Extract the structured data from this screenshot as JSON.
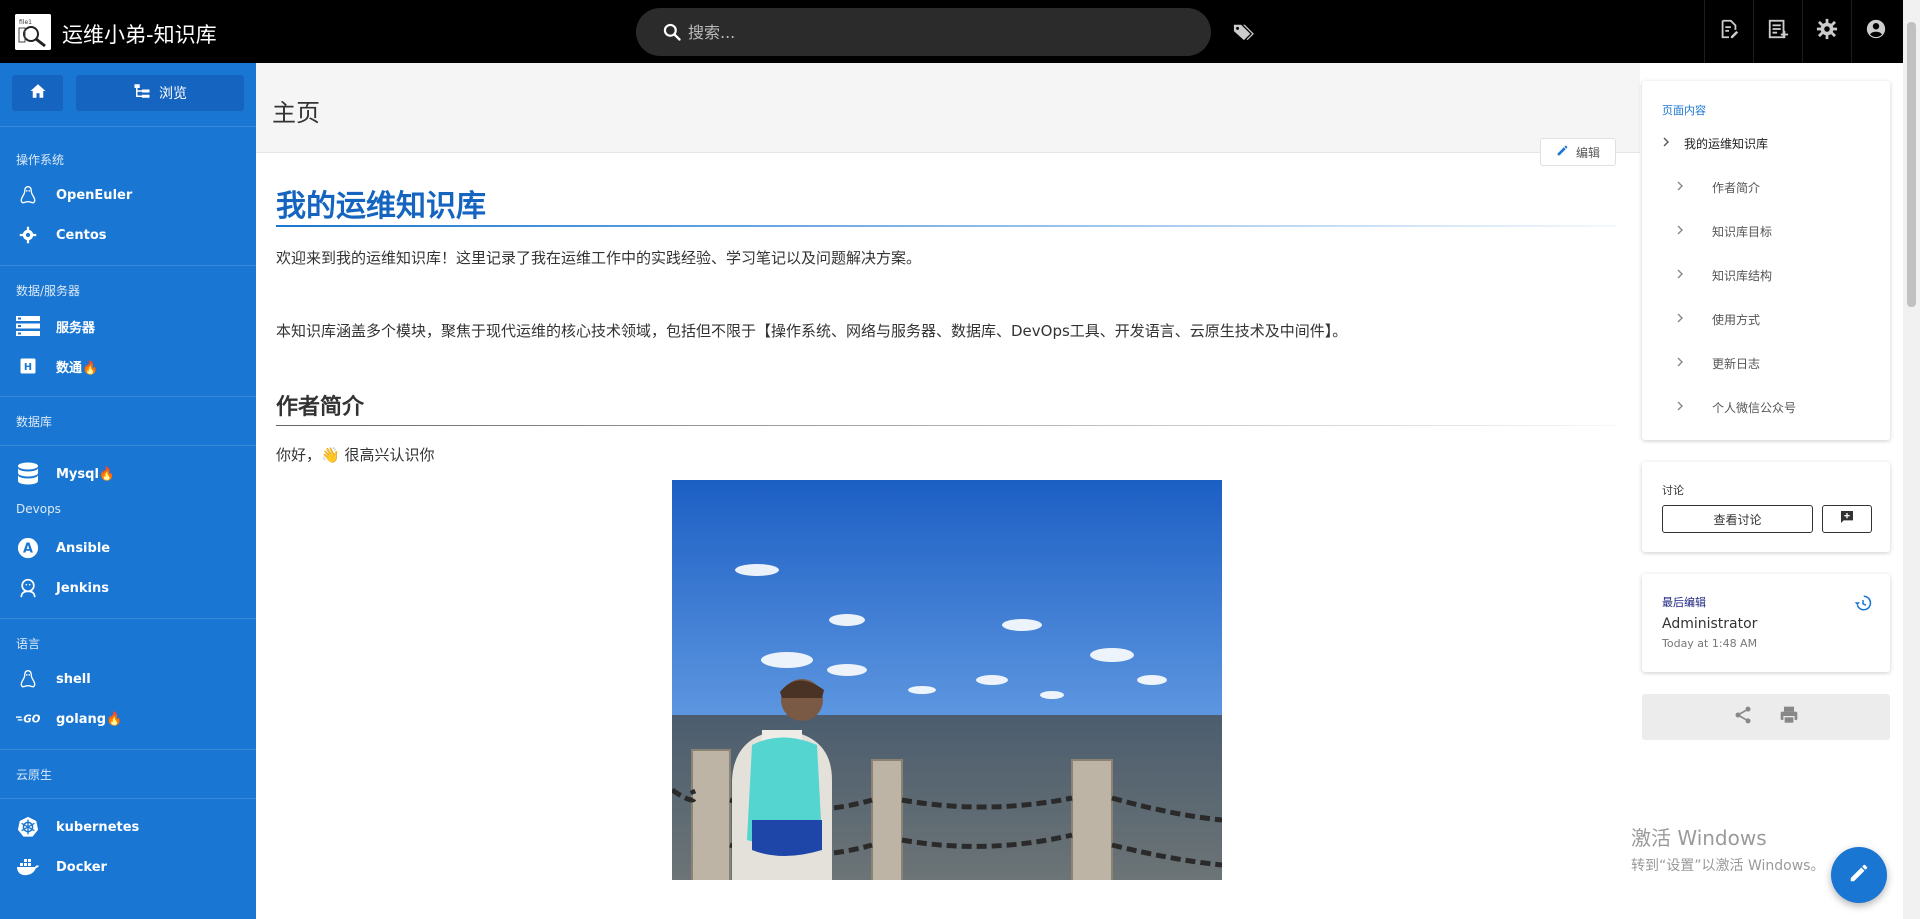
{
  "header": {
    "site_title": "运维小弟-知识库",
    "search_placeholder": "搜索...",
    "icons": [
      "search-icon",
      "tags-icon",
      "new-page-icon",
      "page-actions-icon",
      "settings-icon",
      "account-icon"
    ]
  },
  "nav": {
    "browse_label": "浏览",
    "sections": [
      {
        "header": "操作系统",
        "items": [
          {
            "label": "OpenEuler",
            "icon": "linux-icon"
          },
          {
            "label": "Centos",
            "icon": "gear-icon"
          }
        ]
      },
      {
        "header": "数据/服务器",
        "items": [
          {
            "label": "服务器",
            "icon": "server-icon"
          },
          {
            "label": "数通🔥",
            "icon": "h-badge-icon"
          }
        ]
      },
      {
        "header": "数据库",
        "items": [
          {
            "label": "Mysql🔥",
            "icon": "database-icon"
          }
        ]
      },
      {
        "header": "Devops",
        "items": [
          {
            "label": "Ansible",
            "icon": "ansible-icon"
          },
          {
            "label": "Jenkins",
            "icon": "jenkins-icon"
          }
        ]
      },
      {
        "header": "语言",
        "items": [
          {
            "label": "shell",
            "icon": "linux-icon"
          },
          {
            "label": "golang🔥",
            "icon": "go-icon"
          }
        ]
      },
      {
        "header": "云原生",
        "items": [
          {
            "label": "kubernetes",
            "icon": "kubernetes-icon"
          },
          {
            "label": "Docker",
            "icon": "docker-icon"
          }
        ]
      }
    ]
  },
  "page": {
    "title": "主页",
    "edit_label": "编辑",
    "h1": "我的运维知识库",
    "p1": "欢迎来到我的运维知识库！这里记录了我在运维工作中的实践经验、学习笔记以及问题解决方案。",
    "p2": "本知识库涵盖多个模块，聚焦于现代运维的核心技术领域，包括但不限于【操作系统、网络与服务器、数据库、DevOps工具、开发语言、云原生技术及中间件】。",
    "h2": "作者简介",
    "p3_pre": "你好，",
    "p3_emoji": "👋",
    "p3_post": "很高兴认识你"
  },
  "toc": {
    "title": "页面内容",
    "items": [
      {
        "label": "我的运维知识库",
        "level": 1
      },
      {
        "label": "作者简介",
        "level": 2
      },
      {
        "label": "知识库目标",
        "level": 2
      },
      {
        "label": "知识库结构",
        "level": 2
      },
      {
        "label": "使用方式",
        "level": 2
      },
      {
        "label": "更新日志",
        "level": 2
      },
      {
        "label": "个人微信公众号",
        "level": 2
      }
    ]
  },
  "discussion": {
    "title": "讨论",
    "view_label": "查看讨论"
  },
  "last_edit": {
    "title": "最后编辑",
    "author": "Administrator",
    "time": "Today at 1:48 AM"
  },
  "watermark": {
    "line1": "激活 Windows",
    "line2": "转到“设置”以激活 Windows。"
  },
  "colors": {
    "brand": "#1976d2",
    "topbar": "#000000",
    "heading": "#1565c0"
  }
}
